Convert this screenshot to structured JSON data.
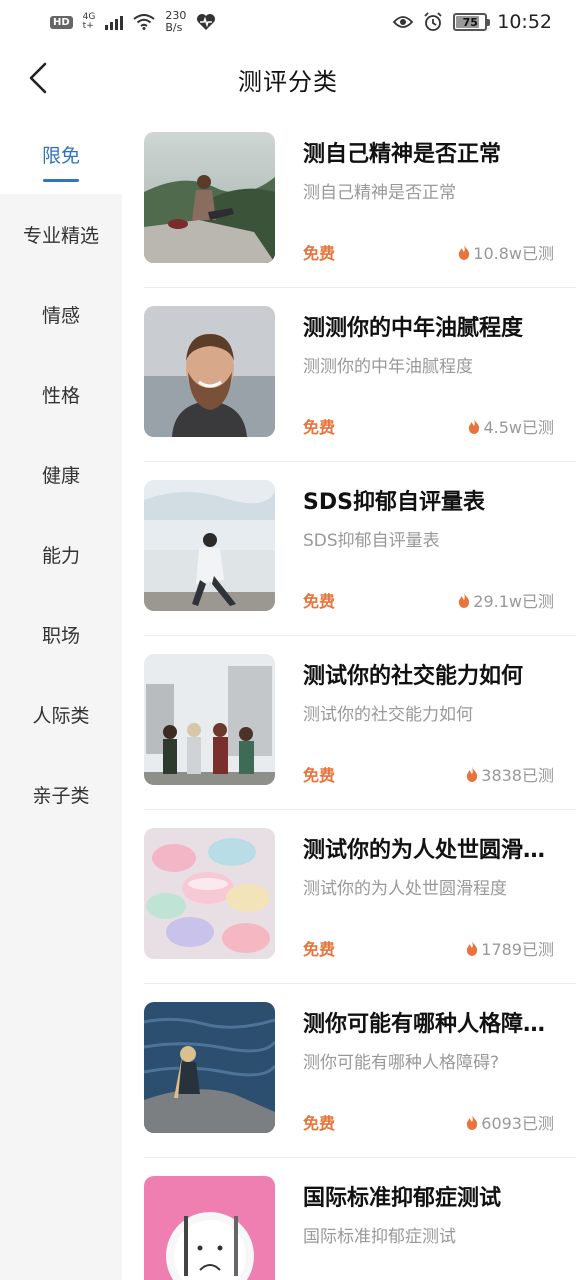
{
  "status_bar": {
    "hd": "HD",
    "net_top": "4G",
    "net_bottom": "t+",
    "speed_value": "230",
    "speed_unit": "B/s",
    "battery": "75",
    "time": "10:52"
  },
  "header": {
    "title": "测评分类"
  },
  "sidebar": {
    "items": [
      {
        "label": "限免",
        "active": true
      },
      {
        "label": "专业精选",
        "active": false
      },
      {
        "label": "情感",
        "active": false
      },
      {
        "label": "性格",
        "active": false
      },
      {
        "label": "健康",
        "active": false
      },
      {
        "label": "能力",
        "active": false
      },
      {
        "label": "职场",
        "active": false
      },
      {
        "label": "人际类",
        "active": false
      },
      {
        "label": "亲子类",
        "active": false
      }
    ]
  },
  "tests": [
    {
      "title": "测自己精神是否正常",
      "subtitle": "测自己精神是否正常",
      "price": "免费",
      "count": "10.8w已测",
      "thumb_icon": "woman-on-cliff-photo"
    },
    {
      "title": "测测你的中年油腻程度",
      "subtitle": "测测你的中年油腻程度",
      "price": "免费",
      "count": "4.5w已测",
      "thumb_icon": "bearded-man-photo"
    },
    {
      "title": "SDS抑郁自评量表",
      "subtitle": "SDS抑郁自评量表",
      "price": "免费",
      "count": "29.1w已测",
      "thumb_icon": "man-by-lake-photo"
    },
    {
      "title": "测试你的社交能力如何",
      "subtitle": "测试你的社交能力如何",
      "price": "免费",
      "count": "3838已测",
      "thumb_icon": "friends-group-photo"
    },
    {
      "title": "测试你的为人处世圆滑…",
      "subtitle": "测试你的为人处世圆滑程度",
      "price": "免费",
      "count": "1789已测",
      "thumb_icon": "candy-pills-photo"
    },
    {
      "title": "测你可能有哪种人格障…",
      "subtitle": "测你可能有哪种人格障碍?",
      "price": "免费",
      "count": "6093已测",
      "thumb_icon": "girl-by-sea-photo"
    },
    {
      "title": "国际标准抑郁症测试",
      "subtitle": "国际标准抑郁症测试",
      "price": "免费",
      "count": "",
      "thumb_icon": "sad-plate-photo"
    }
  ],
  "colors": {
    "accent_blue": "#2f74c0",
    "free_orange": "#e8743b",
    "sidebar_bg": "#f5f5f5"
  }
}
